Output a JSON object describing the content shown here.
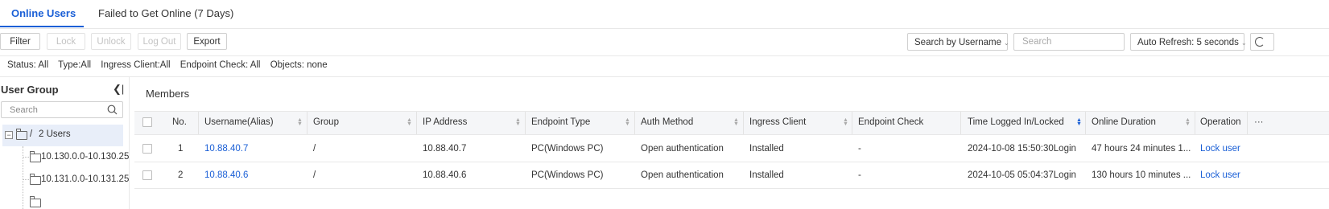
{
  "tabs": {
    "online_users": "Online Users",
    "failed": "Failed to Get Online (7 Days)"
  },
  "toolbar": {
    "filter": "Filter",
    "lock": "Lock",
    "unlock": "Unlock",
    "logout": "Log Out",
    "export": "Export",
    "search_by": "Search by Username",
    "search_placeholder": "Search",
    "auto_refresh": "Auto Refresh: 5 seconds"
  },
  "filters": {
    "status": "Status: All",
    "type": "Type:All",
    "ingress": "Ingress Client:All",
    "endpoint": "Endpoint Check: All",
    "objects": "Objects: none"
  },
  "sidebar": {
    "title": "User Group",
    "search_placeholder": "Search",
    "root_slash": "/",
    "root_label": "2 Users",
    "children": [
      "10.130.0.0-10.130.25",
      "10.131.0.0-10.131.25"
    ]
  },
  "members": {
    "title": "Members",
    "columns": [
      "No.",
      "Username(Alias)",
      "Group",
      "IP Address",
      "Endpoint Type",
      "Auth Method",
      "Ingress Client",
      "Endpoint Check",
      "Time Logged In/Locked",
      "Online Duration",
      "Operation"
    ],
    "more": "···",
    "rows": [
      {
        "no": "1",
        "username": "10.88.40.7",
        "group": "/",
        "ip": "10.88.40.7",
        "endpoint_type": "PC(Windows PC)",
        "auth": "Open authentication",
        "ingress": "Installed",
        "check": "-",
        "time": "2024-10-08 15:50:30Login",
        "duration": "47 hours 24 minutes 1...",
        "operation": "Lock user"
      },
      {
        "no": "2",
        "username": "10.88.40.6",
        "group": "/",
        "ip": "10.88.40.6",
        "endpoint_type": "PC(Windows PC)",
        "auth": "Open authentication",
        "ingress": "Installed",
        "check": "-",
        "time": "2024-10-05 05:04:37Login",
        "duration": "130 hours 10 minutes ...",
        "operation": "Lock user"
      }
    ]
  },
  "colors": {
    "accent": "#1a5fd6",
    "header_bg": "#f5f6f8",
    "selected_bg": "#e8eef9"
  }
}
